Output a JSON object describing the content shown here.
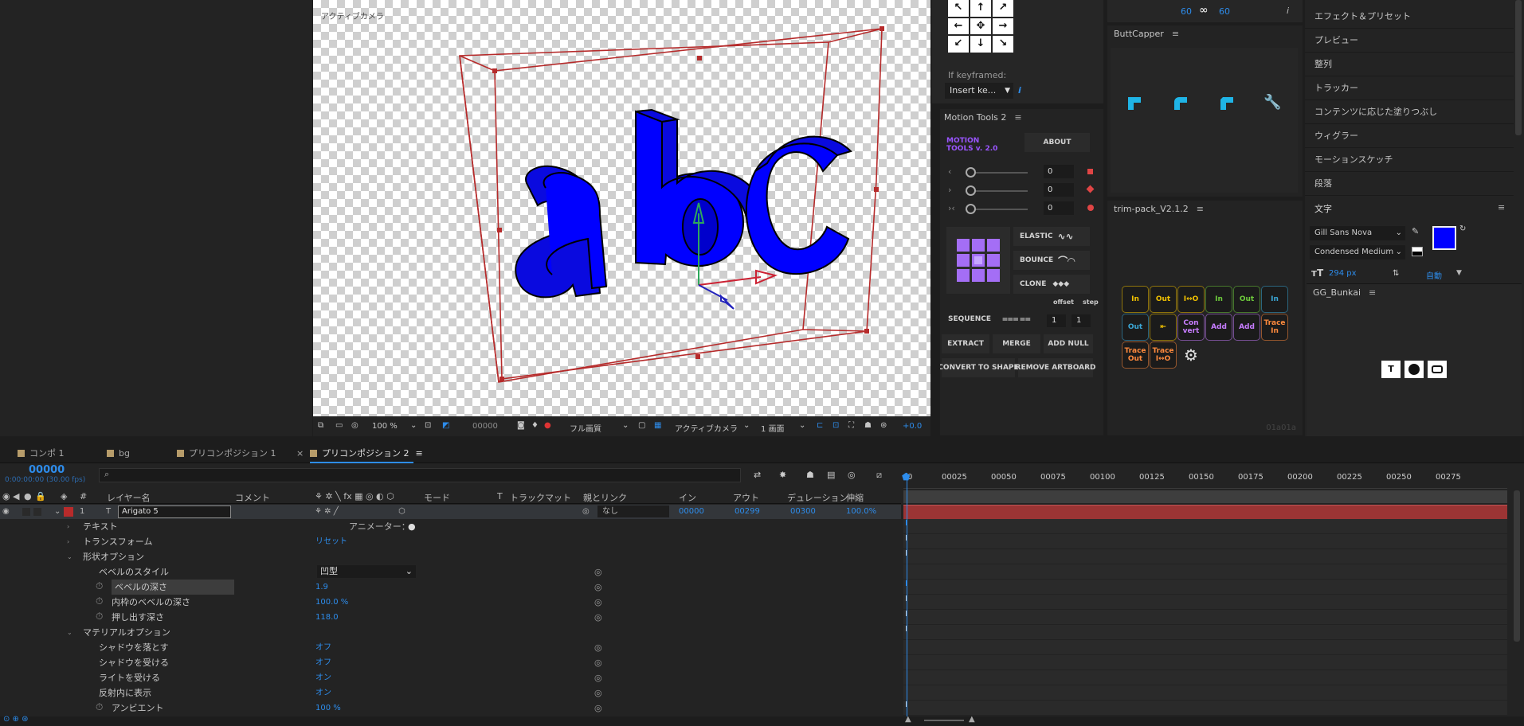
{
  "viewer": {
    "label": "アクティブカメラ",
    "toolbar": {
      "zoom": "100 %",
      "timecode": "00000",
      "resolution": "フル画質",
      "camera": "アクティブカメラ",
      "views": "1 画面",
      "exposure": "+0.0"
    }
  },
  "mini_panel": {
    "val_left": "60",
    "link": "∞",
    "val_right": "60",
    "info": "i",
    "if_keyframed": "If keyframed:",
    "insert_dropdown": "Insert ke...",
    "info2": "i"
  },
  "buttcapper": {
    "title": "ButtCapper",
    "icons": [
      "cap-butt-icon",
      "cap-round-icon",
      "cap-square-icon",
      "wrench-icon"
    ]
  },
  "motion_tools": {
    "title": "Motion Tools 2",
    "logo_line1": "MOTION",
    "logo_line2": "TOOLS v. 2.0",
    "about": "ABOUT",
    "sliders": [
      {
        "icon": "‹",
        "value": "0"
      },
      {
        "icon": "›",
        "value": "0"
      },
      {
        "icon": "›‹",
        "value": "0"
      }
    ],
    "elastic": "ELASTIC",
    "bounce": "BOUNCE",
    "clone": "CLONE",
    "offset": "offset",
    "step": "step",
    "sequence": "SEQUENCE",
    "seq_offset": "1",
    "seq_step": "1",
    "extract": "EXTRACT",
    "merge": "MERGE",
    "add_null": "ADD NULL",
    "convert_to_shape": "CONVERT TO SHAPE",
    "remove_artboard": "REMOVE ARTBOARD"
  },
  "trim_pack": {
    "title": "trim-pack_V2.1.2",
    "version": "01a01a",
    "buttons": [
      {
        "label": "In",
        "color": "#f2c200",
        "row": 0
      },
      {
        "label": "Out",
        "color": "#f2c200",
        "row": 0
      },
      {
        "label": "I↔O",
        "color": "#f2c200",
        "row": 0
      },
      {
        "label": "In",
        "color": "#6ecb3c",
        "row": 0
      },
      {
        "label": "Out",
        "color": "#6ecb3c",
        "row": 0
      },
      {
        "label": "In",
        "color": "#3ba7d6",
        "row": 0
      },
      {
        "label": "Out",
        "color": "#3ba7d6",
        "row": 1
      },
      {
        "label": "⇤",
        "color": "#f2c200",
        "row": 1
      },
      {
        "label": "Con vert",
        "color": "#c77dff",
        "row": 1
      },
      {
        "label": "Add",
        "color": "#c77dff",
        "row": 1
      },
      {
        "label": "Add",
        "color": "#c77dff",
        "row": 1
      },
      {
        "label": "Trace In",
        "color": "#ff8a3d",
        "row": 1
      },
      {
        "label": "Trace Out",
        "color": "#ff8a3d",
        "row": 2
      },
      {
        "label": "Trace I↔O",
        "color": "#ff8a3d",
        "row": 2
      },
      {
        "label": "⚙",
        "color": "#e0e0e0",
        "row": 2
      }
    ]
  },
  "right_panel": {
    "items": [
      "エフェクト＆プリセット",
      "プレビュー",
      "整列",
      "トラッカー",
      "コンテンツに応じた塗りつぶし",
      "ウィグラー",
      "モーションスケッチ",
      "段落"
    ],
    "text_title": "文字",
    "font": "Gill Sans Nova",
    "style": "Condensed Medium",
    "size": "294 px",
    "leading": "自動",
    "gg_title": "GG_Bunkai",
    "fill_color": "#0000ff"
  },
  "tabs": [
    {
      "label": "コンポ 1",
      "color": "#b79c6a"
    },
    {
      "label": "bg",
      "color": "#b79c6a"
    },
    {
      "label": "プリコンポジション 1",
      "color": "#b79c6a",
      "closable": "×"
    },
    {
      "label": "プリコンポジション 2",
      "color": "#b79c6a",
      "menu": "≡"
    }
  ],
  "timeline": {
    "timecode": "00000",
    "timecode_sub": "0:00:00:00 (30.00 fps)",
    "search_placeholder": "",
    "headers": {
      "num": "#",
      "layer": "レイヤー名",
      "comment": "コメント",
      "mode": "モード",
      "trkmat": "トラックマット",
      "parent": "親とリンク",
      "in": "イン",
      "out": "アウト",
      "duration": "デュレーション",
      "stretch": "伸縮"
    },
    "layer": {
      "index": "1",
      "type": "T",
      "name": "Arigato 5",
      "parent": "なし",
      "in": "00000",
      "out": "00299",
      "duration": "00300",
      "stretch": "100.0%",
      "color": "#b82b2b"
    },
    "ruler": [
      "00025",
      "00050",
      "00075",
      "00100",
      "00125",
      "00150",
      "00175",
      "00200",
      "00225",
      "00250",
      "00275"
    ],
    "ruler_start": "0",
    "rows": [
      {
        "indent": 1,
        "tri": "›",
        "label": "テキスト",
        "extra": "アニメーター：",
        "extra_icon": "●"
      },
      {
        "indent": 1,
        "tri": "›",
        "label": "トランスフォーム",
        "value": "リセット"
      },
      {
        "indent": 1,
        "tri": "⌄",
        "label": "形状オプション"
      },
      {
        "indent": 2,
        "label": "ベベルのスタイル",
        "dropdown": "凹型"
      },
      {
        "indent": 2,
        "stopwatch": true,
        "label": "ベベルの深さ",
        "value": "1.9",
        "selected": true
      },
      {
        "indent": 2,
        "stopwatch": true,
        "label": "内枠のベベルの深さ",
        "value": "100.0 %"
      },
      {
        "indent": 2,
        "stopwatch": true,
        "label": "押し出す深さ",
        "value": "118.0"
      },
      {
        "indent": 1,
        "tri": "⌄",
        "label": "マテリアルオプション"
      },
      {
        "indent": 2,
        "label": "シャドウを落とす",
        "value": "オフ"
      },
      {
        "indent": 2,
        "label": "シャドウを受ける",
        "value": "オフ"
      },
      {
        "indent": 2,
        "label": "ライトを受ける",
        "value": "オン"
      },
      {
        "indent": 2,
        "label": "反射内に表示",
        "value": "オン"
      },
      {
        "indent": 2,
        "stopwatch": true,
        "label": "アンビエント",
        "value": "100 %"
      }
    ]
  },
  "colors": {
    "accent": "#2d8ceb",
    "layer_bar": "#9b3434",
    "bbox": "#b62b2b",
    "text3d": "#0000ff"
  }
}
